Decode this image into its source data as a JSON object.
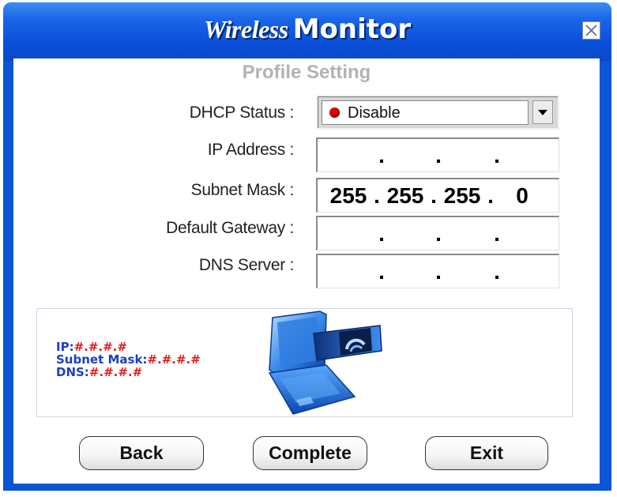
{
  "window": {
    "title_part1": "Wireless",
    "title_part2": "Monitor",
    "close_icon": "close-icon"
  },
  "subtitle": "Profile Setting",
  "form": {
    "dhcp_label": "DHCP Status :",
    "dhcp_value": "Disable",
    "dhcp_indicator_color": "#e10000",
    "ip_label": "IP Address :",
    "ip_value": [
      "",
      "",
      "",
      ""
    ],
    "mask_label": "Subnet Mask :",
    "mask_value": [
      "255",
      "255",
      "255",
      "0"
    ],
    "gateway_label": "Default Gateway :",
    "gateway_value": [
      "",
      "",
      "",
      ""
    ],
    "dns_label": "DNS Server :",
    "dns_value": [
      "",
      "",
      "",
      ""
    ],
    "separator": "."
  },
  "info": {
    "ip_label": "IP:",
    "ip_value": "#.#.#.#",
    "mask_label": "Subnet Mask:",
    "mask_value": "#.#.#.#",
    "dns_label": "DNS:",
    "dns_value": "#.#.#.#",
    "label_color": "#1b3fbf",
    "value_color": "#e21b1b",
    "image": "laptop-wireless-card-icon"
  },
  "buttons": {
    "back": "Back",
    "complete": "Complete",
    "exit": "Exit"
  },
  "colors": {
    "titlebar": "#0b4fd8",
    "subtitle": "#b3b3b3"
  }
}
